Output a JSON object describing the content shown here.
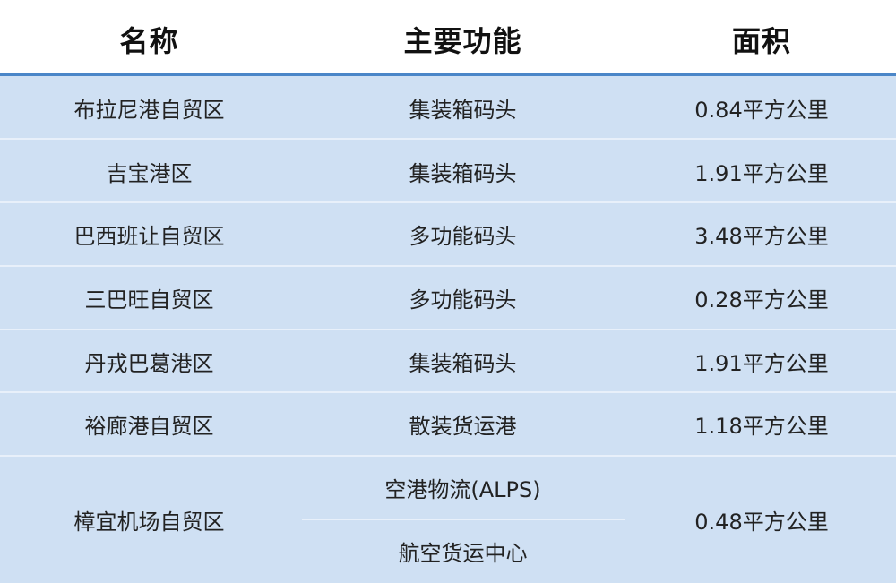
{
  "header": {
    "name": "名称",
    "function": "主要功能",
    "area": "面积"
  },
  "rows": [
    {
      "name": "布拉尼港自贸区",
      "function": "集装箱码头",
      "area": "0.84平方公里"
    },
    {
      "name": "吉宝港区",
      "function": "集装箱码头",
      "area": "1.91平方公里"
    },
    {
      "name": "巴西班让自贸区",
      "function": "多功能码头",
      "area": "3.48平方公里"
    },
    {
      "name": "三巴旺自贸区",
      "function": "多功能码头",
      "area": "0.28平方公里"
    },
    {
      "name": "丹戎巴葛港区",
      "function": "集装箱码头",
      "area": "1.91平方公里"
    },
    {
      "name": "裕廊港自贸区",
      "function": "散装货运港",
      "area": "1.18平方公里"
    }
  ],
  "last_row": {
    "name": "樟宜机场自贸区",
    "functions": [
      "空港物流(ALPS)",
      "航空货运中心"
    ],
    "area": "0.48平方公里"
  },
  "colors": {
    "header_rule": "#4a86c8",
    "body_background": "#cfe0f3",
    "row_separator": "#e8f0fa"
  }
}
